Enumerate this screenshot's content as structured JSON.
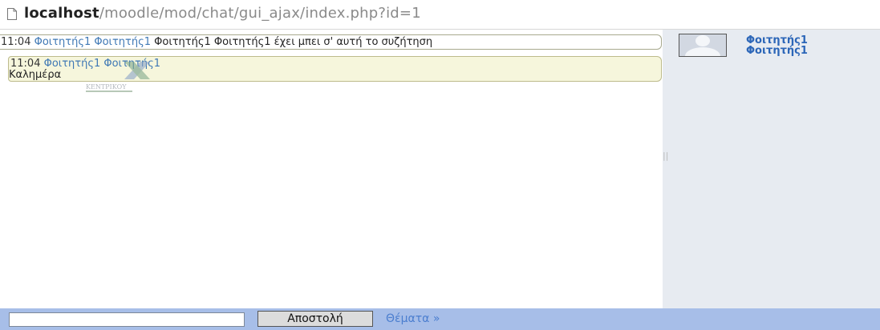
{
  "address_bar": {
    "host": "localhost",
    "path": "/moodle/mod/chat/gui_ajax/index.php?id=1"
  },
  "chat": {
    "system_message": {
      "time": "11:04",
      "user_link_1": "Φοιτητής1",
      "user_link_2": "Φοιτητής1",
      "text": "Φοιτητής1 Φοιτητής1 έχει μπει σ' αυτή το συζήτηση"
    },
    "user_message": {
      "time": "11:04",
      "author": "Φοιτητής1 Φοιτητής1",
      "text": "Καλημέρα"
    },
    "watermark_logo_text": "ΚΕΝΤΡΙΚΟΥ"
  },
  "users": {
    "list": [
      {
        "first_name": "Φοιτητής1",
        "last_name": "Φοιτητής1"
      }
    ],
    "divider_handle": "||"
  },
  "bottom_bar": {
    "input_value": "",
    "send_label": "Αποστολή",
    "topics_label": "Θέματα »"
  },
  "colors": {
    "link": "#3f78b5",
    "user_panel_bg": "#e7ebf1",
    "bottom_bar_bg": "#a7bee8",
    "message_bg": "#f6f6dc"
  }
}
